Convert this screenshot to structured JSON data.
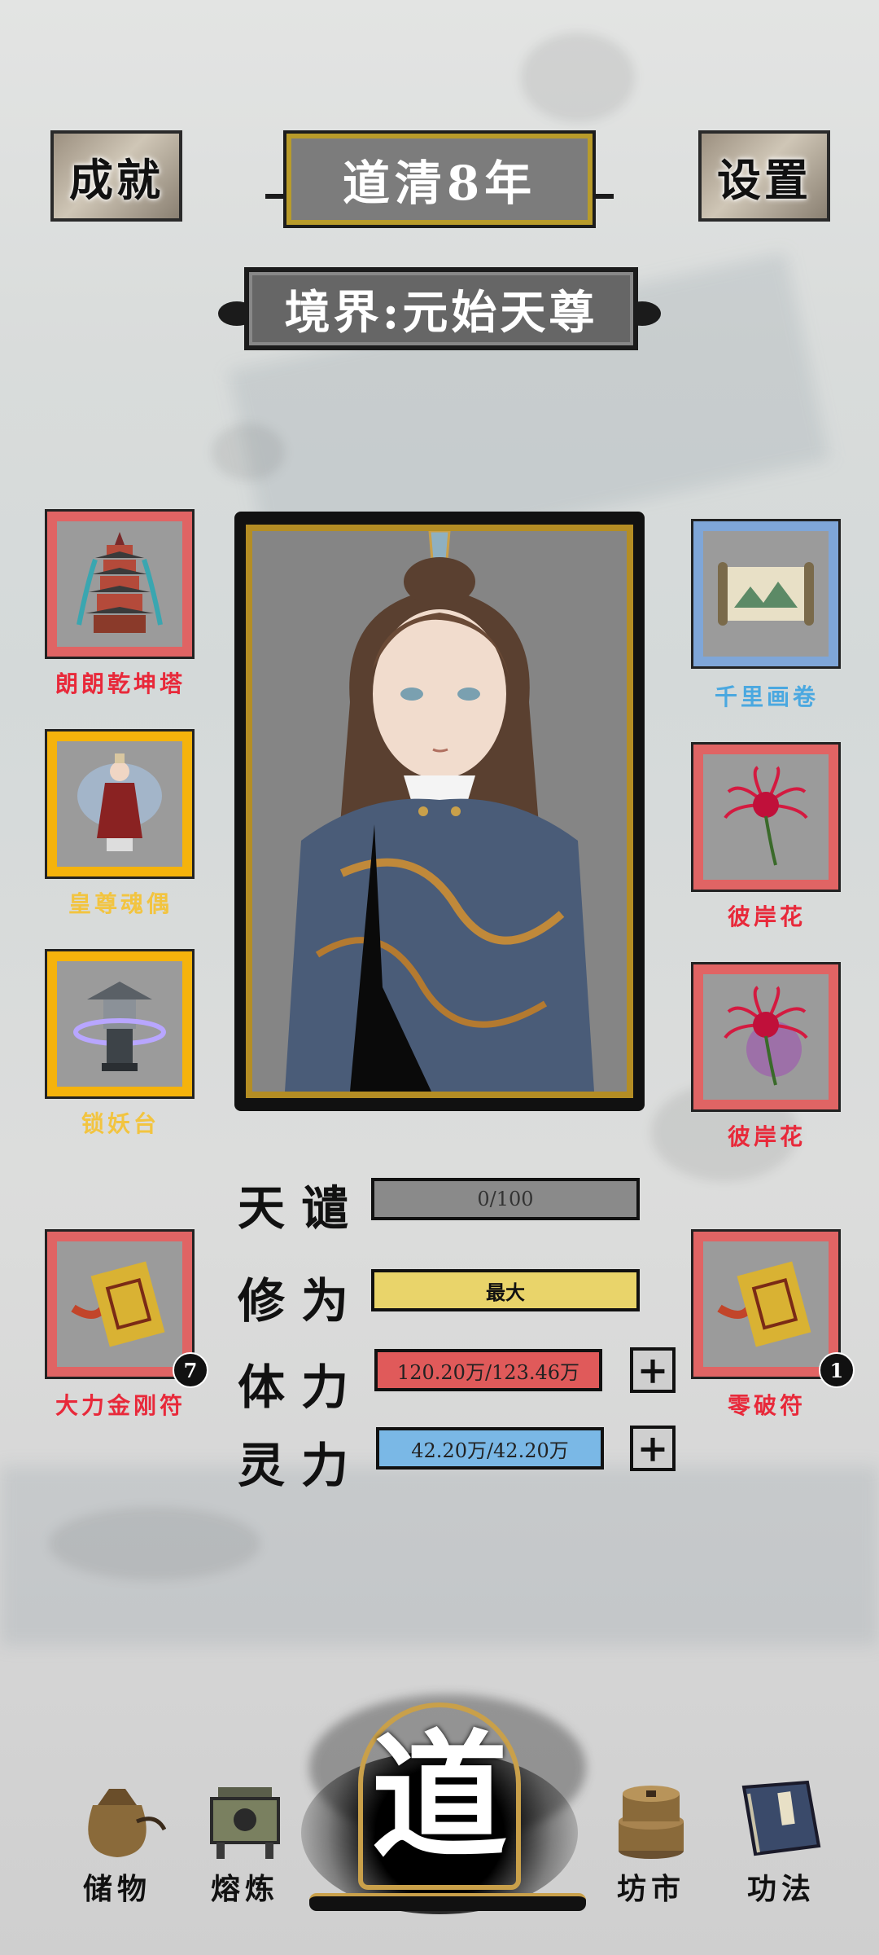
{
  "header": {
    "achievements_label": "成就",
    "year_title": "道清8年",
    "settings_label": "设置",
    "realm": "境界:元始天尊"
  },
  "equipment": {
    "left": [
      {
        "label": "朗朗乾坤塔",
        "frame": "red",
        "icon": "pagoda-icon"
      },
      {
        "label": "皇尊魂偶",
        "frame": "gold",
        "icon": "figurine-icon"
      },
      {
        "label": "锁妖台",
        "frame": "gold",
        "icon": "lantern-icon"
      },
      {
        "label": "大力金刚符",
        "frame": "red",
        "icon": "talisman-icon",
        "count": "7"
      }
    ],
    "right": [
      {
        "label": "千里画卷",
        "frame": "blue",
        "icon": "scroll-icon"
      },
      {
        "label": "彼岸花",
        "frame": "red",
        "icon": "spider-lily-icon"
      },
      {
        "label": "彼岸花",
        "frame": "red",
        "icon": "spider-lily-icon"
      },
      {
        "label": "零破符",
        "frame": "red",
        "icon": "talisman-icon",
        "count": "1"
      }
    ]
  },
  "label_colors": {
    "red": "#e8293a",
    "gold": "#f2c440",
    "blue": "#4aa8e0"
  },
  "stats": {
    "tribulation": {
      "label": "天谴",
      "value": "0/100",
      "fill": 0.0
    },
    "cultivation": {
      "label": "修为",
      "value": "最大",
      "fill": 1.0
    },
    "stamina": {
      "label": "体力",
      "value": "120.20万/123.46万",
      "fill": 0.97
    },
    "spirit": {
      "label": "灵力",
      "value": "42.20万/42.20万",
      "fill": 1.0
    }
  },
  "nav": {
    "storage": "储物",
    "smelting": "熔炼",
    "center": "道",
    "market": "坊市",
    "techniques": "功法"
  }
}
